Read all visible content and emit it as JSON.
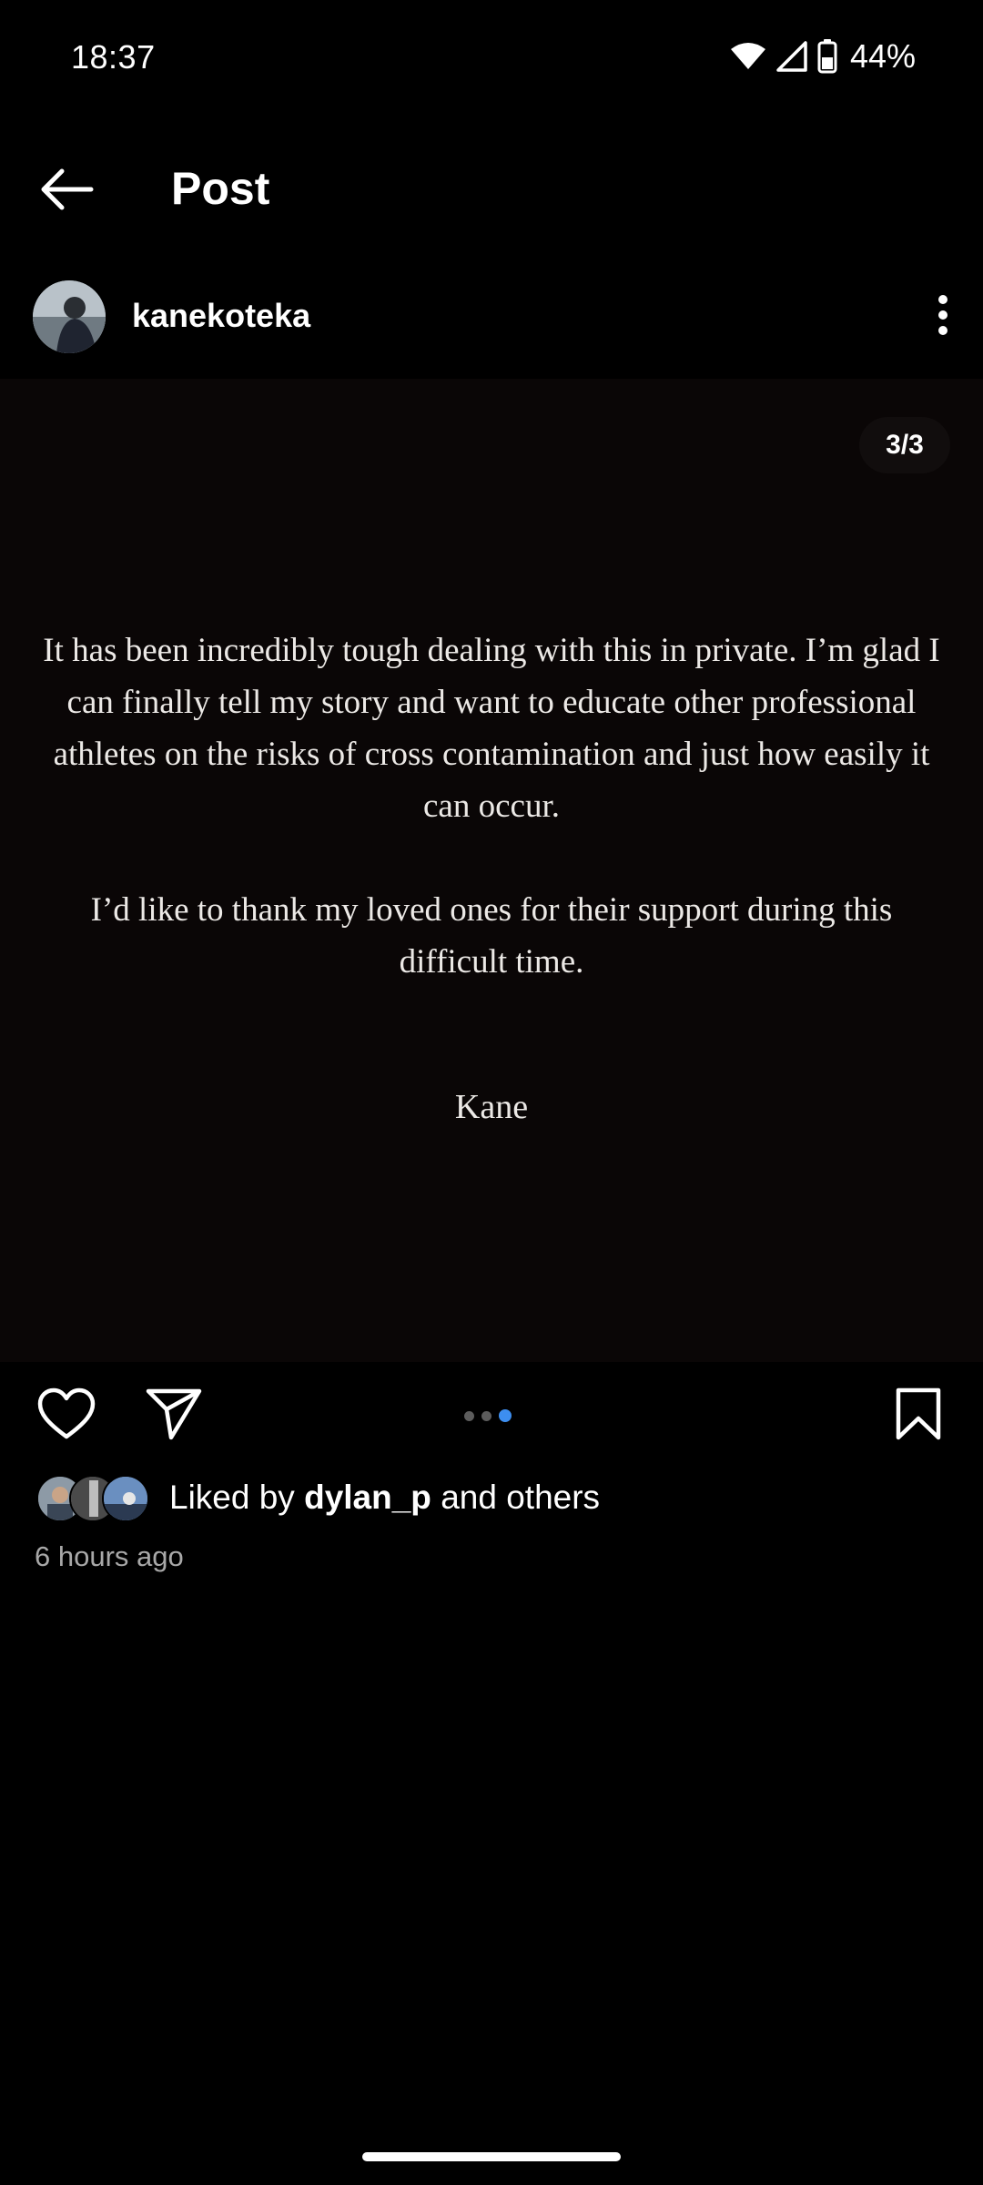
{
  "status_bar": {
    "time": "18:37",
    "battery": "44%",
    "icons": [
      "wifi-icon",
      "cell-signal-icon",
      "battery-icon"
    ]
  },
  "app_bar": {
    "title": "Post",
    "back_icon": "arrow-left-icon"
  },
  "post": {
    "username": "kanekoteka",
    "page_counter": "3/3",
    "carousel": {
      "total": 3,
      "current": 3
    },
    "paragraph_1": "It has been incredibly tough dealing with this in private. I’m glad I can finally tell my story and want to educate other professional athletes on the risks of cross contamination and just how easily it can occur.",
    "paragraph_2": "I’d like to thank my loved ones for their support during this difficult time.",
    "signature": "Kane",
    "likes_prefix": "Liked by ",
    "likes_user": "dylan_p",
    "likes_suffix": " and others",
    "timestamp": "6 hours ago"
  },
  "colors": {
    "background": "#000000",
    "media_background": "#0a0606",
    "active_dot": "#3d8ef0",
    "muted_text": "#a8a8a8"
  }
}
